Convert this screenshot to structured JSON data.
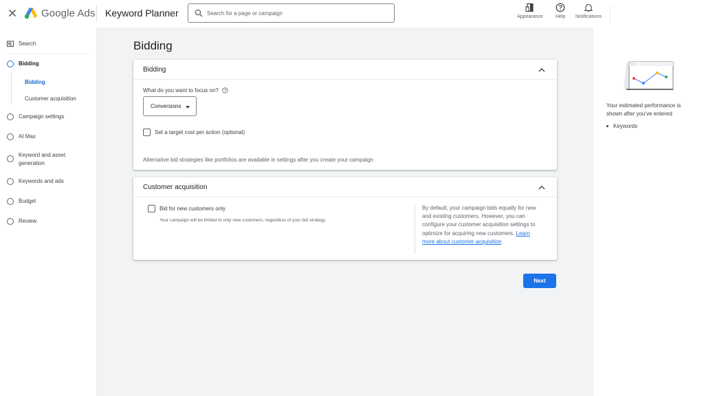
{
  "header": {
    "brand": "Google Ads",
    "tool_title": "Keyword Planner",
    "search_placeholder": "Search for a page or campaign",
    "actions": [
      {
        "label": "Appearance",
        "icon": "appearance-icon"
      },
      {
        "label": "Help",
        "icon": "help-icon"
      },
      {
        "label": "Notifications",
        "icon": "bell-icon"
      }
    ]
  },
  "sidebar": {
    "search_label": "Search",
    "items": [
      {
        "label": "Bidding",
        "active": true
      },
      {
        "label": "Campaign settings"
      },
      {
        "label": "AI Max"
      },
      {
        "label": "Keyword and asset generation"
      },
      {
        "label": "Keywords and ads"
      },
      {
        "label": "Budget"
      },
      {
        "label": "Review"
      }
    ],
    "sub_items": [
      {
        "label": "Bidding",
        "active": true
      },
      {
        "label": "Customer acquisition"
      }
    ]
  },
  "main": {
    "page_title": "Bidding",
    "bidding_card": {
      "title": "Bidding",
      "question": "What do you want to focus on?",
      "focus_value": "Conversions",
      "target_cpa_label": "Set a target cost per action (optional)",
      "alt_text": "Alternative bid strategies like portfolios are available in settings after you create your campaign"
    },
    "acquisition_card": {
      "title": "Customer acquisition",
      "checkbox_label": "Bid for new customers only",
      "checkbox_note": "Your campaign will be limited to only new customers, regardless of your bid strategy",
      "description": "By default, your campaign bids equally for new and existing customers. However, you can configure your customer acquisition settings to optimize for acquiring new customers.",
      "learn_more": "Learn more about customer acquisition"
    },
    "next_label": "Next"
  },
  "right_panel": {
    "text": "Your estimated performance is shown after you've entered",
    "list_item": "Keywords"
  },
  "colors": {
    "accent": "#1a73e8",
    "background": "#f1f3f4"
  }
}
